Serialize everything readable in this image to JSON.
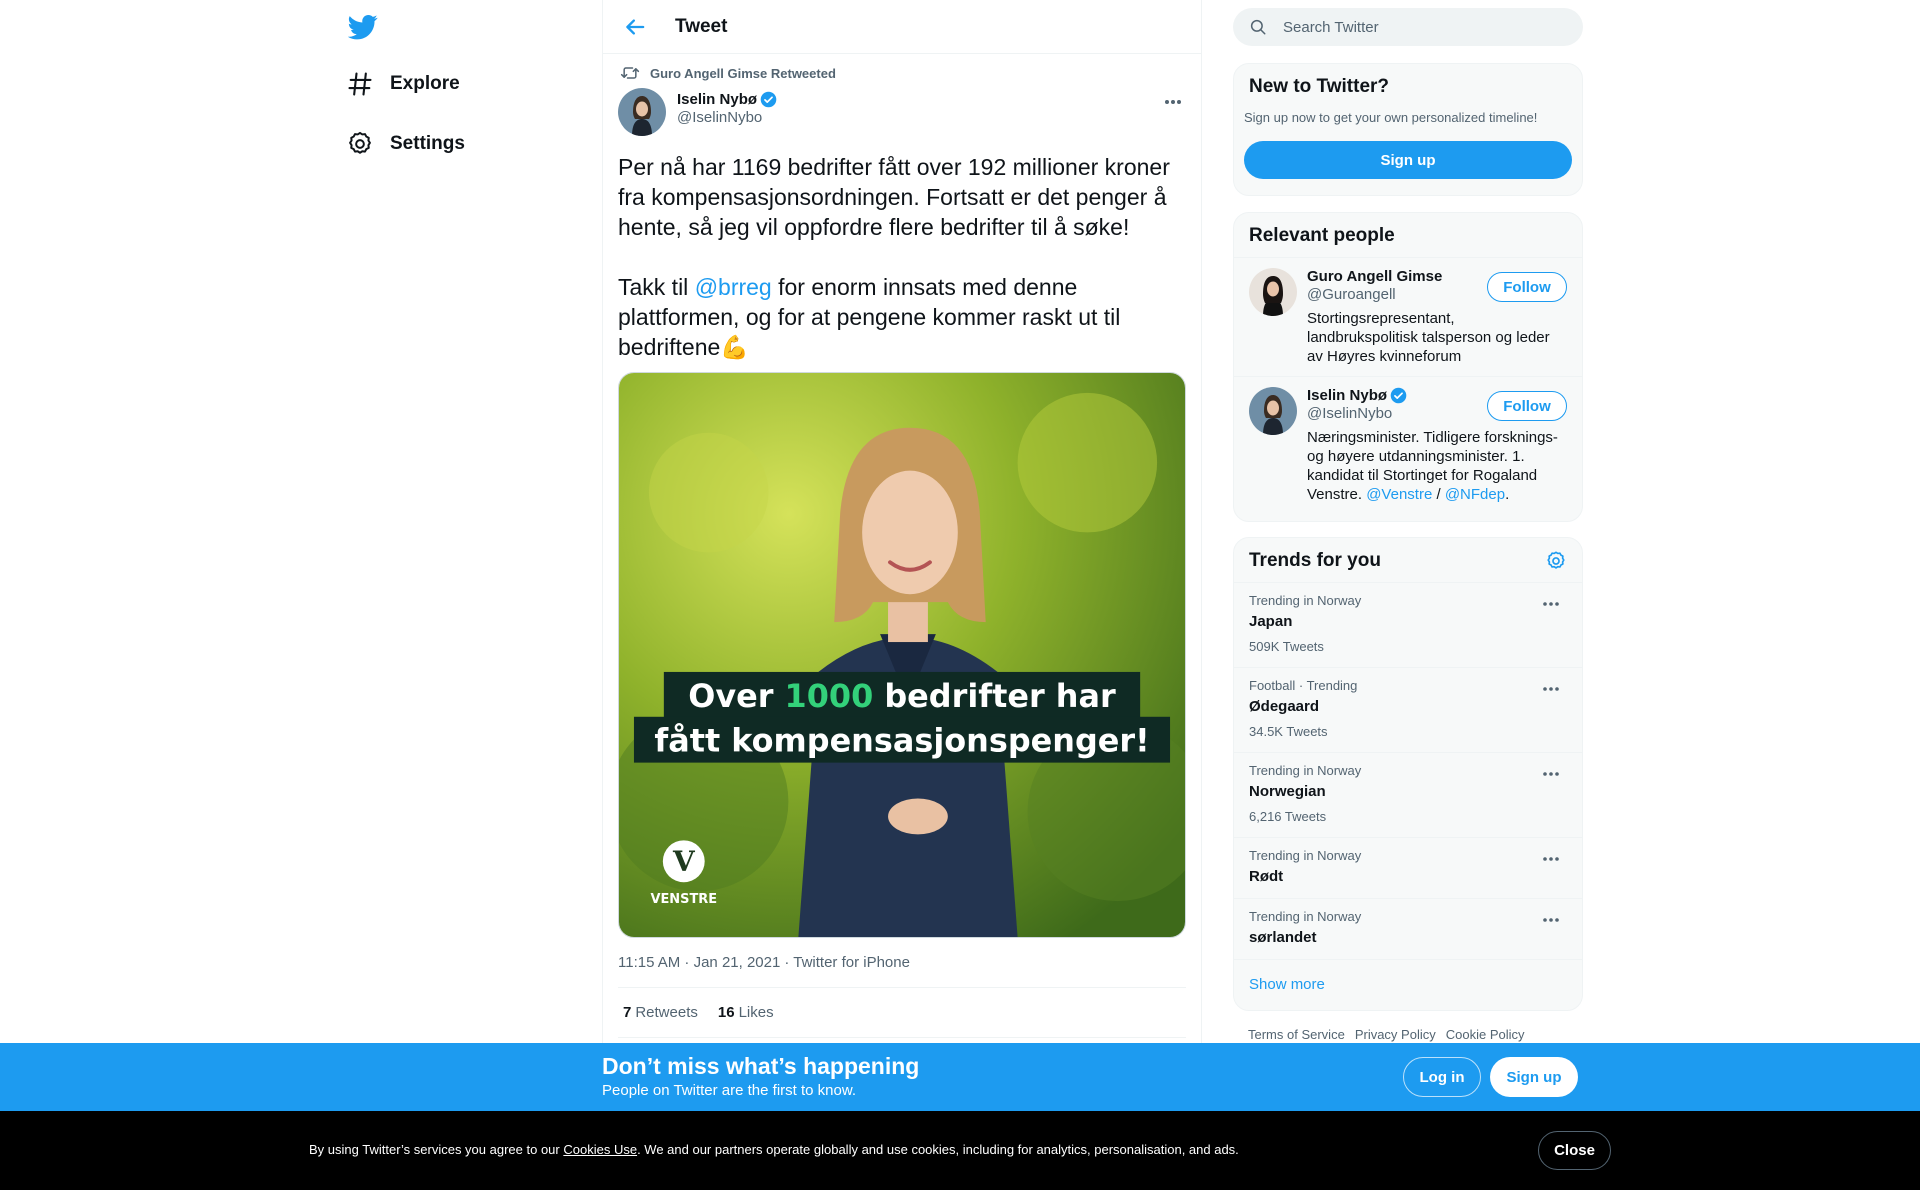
{
  "colors": {
    "accent": "#1d9bf0",
    "text": "#0f1419",
    "muted": "#536471"
  },
  "nav": {
    "logo_icon": "twitter-bird-icon",
    "items": [
      {
        "label": "Explore",
        "icon": "hashtag-icon"
      },
      {
        "label": "Settings",
        "icon": "gear-icon"
      }
    ]
  },
  "header": {
    "title": "Tweet",
    "back_icon": "arrow-left-icon"
  },
  "tweet": {
    "retweeted_by": "Guro Angell Gimse Retweeted",
    "author_name": "Iselin Nybø",
    "author_handle": "@IselinNybo",
    "text_p1": "Per nå har 1169 bedrifter fått over 192 millioner kroner fra kompensasjonsordningen. Fortsatt er det penger å hente, så jeg vil oppfordre flere bedrifter til å søke!",
    "text_p2_before": "Takk til ",
    "text_p2_mention": "@brreg",
    "text_p2_after": " for enorm innsats med denne plattformen, og for at pengene kommer raskt ut til bedriftene💪",
    "image": {
      "headline_part1": "Over ",
      "headline_highlight": "1000",
      "headline_part2": " bedrifter har",
      "headline_line2": "fått kompensasjonspenger!",
      "logo_letter": "V",
      "logo_text": "VENSTRE"
    },
    "time": "11:15 AM · Jan 21, 2021",
    "source": "· Twitter for iPhone",
    "retweets_count": "7",
    "retweets_label": "Retweets",
    "likes_count": "16",
    "likes_label": "Likes"
  },
  "search": {
    "placeholder": "Search Twitter"
  },
  "new_to_twitter": {
    "title": "New to Twitter?",
    "subtitle": "Sign up now to get your own personalized timeline!",
    "signup_label": "Sign up"
  },
  "relevant_people": {
    "title": "Relevant people",
    "people": [
      {
        "name": "Guro Angell Gimse",
        "handle": "@Guroangell",
        "bio": "Stortingsrepresentant, landbrukspolitisk talsperson og leder av Høyres kvinneforum",
        "follow_label": "Follow"
      },
      {
        "name": "Iselin Nybø",
        "handle": "@IselinNybo",
        "bio_text": "Næringsminister. Tidligere forsknings- og høyere utdanningsminister. 1. kandidat til Stortinget for Rogaland Venstre. ",
        "bio_link1": "@Venstre",
        "bio_sep": " / ",
        "bio_link2": "@NFdep",
        "bio_end": ".",
        "follow_label": "Follow"
      }
    ]
  },
  "trends": {
    "title": "Trends for you",
    "items": [
      {
        "context": "Trending in Norway",
        "name": "Japan",
        "count": "509K Tweets"
      },
      {
        "context": "Football · Trending",
        "name": "Ødegaard",
        "count": "34.5K Tweets"
      },
      {
        "context": "Trending in Norway",
        "name": "Norwegian",
        "count": "6,216 Tweets"
      },
      {
        "context": "Trending in Norway",
        "name": "Rødt",
        "count": ""
      },
      {
        "context": "Trending in Norway",
        "name": "sørlandet",
        "count": ""
      }
    ],
    "show_more": "Show more"
  },
  "footer": {
    "links": [
      "Terms of Service",
      "Privacy Policy",
      "Cookie Policy"
    ]
  },
  "bottom_bar": {
    "title": "Don’t miss what’s happening",
    "subtitle": "People on Twitter are the first to know.",
    "login_label": "Log in",
    "signup_label": "Sign up"
  },
  "cookie": {
    "text_before": "By using Twitter’s services you agree to our ",
    "link": "Cookies Use",
    "text_after": ". We and our partners operate globally and use cookies, including for analytics, personalisation, and ads.",
    "close_label": "Close"
  }
}
